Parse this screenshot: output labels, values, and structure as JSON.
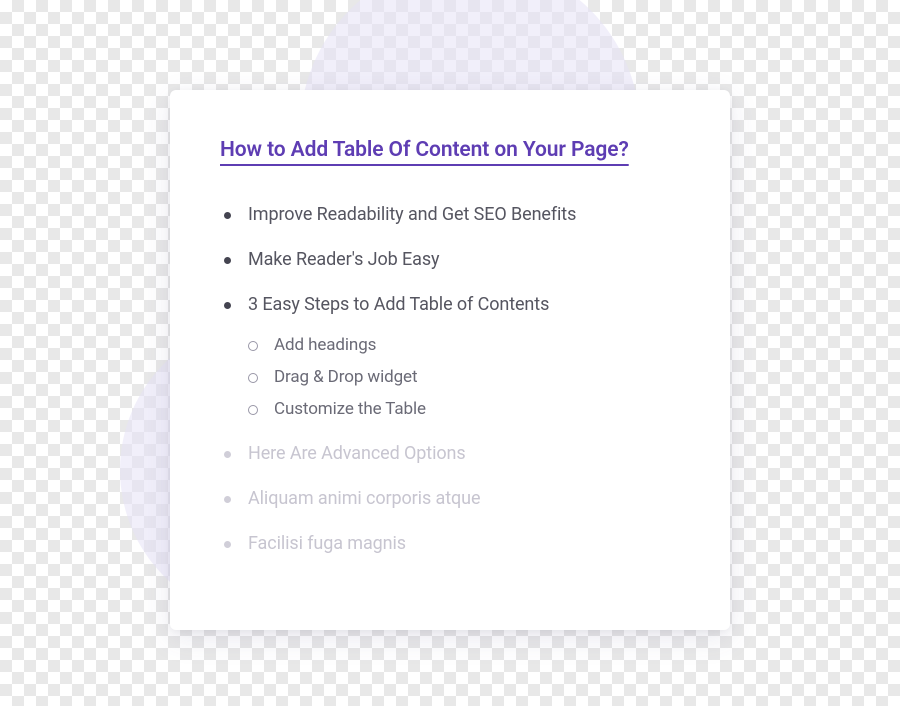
{
  "title": "How to Add Table Of Content on Your Page?",
  "items": [
    {
      "label": "Improve Readability and Get SEO Benefits"
    },
    {
      "label": "Make Reader's Job Easy"
    },
    {
      "label": "3 Easy Steps to Add Table of Contents",
      "children": [
        {
          "label": "Add headings"
        },
        {
          "label": "Drag & Drop widget"
        },
        {
          "label": "Customize the Table"
        }
      ]
    },
    {
      "label": "Here Are Advanced Options",
      "faded": true
    },
    {
      "label": "Aliquam animi corporis atque",
      "faded": true
    },
    {
      "label": "Facilisi fuga magnis",
      "faded": true
    }
  ]
}
